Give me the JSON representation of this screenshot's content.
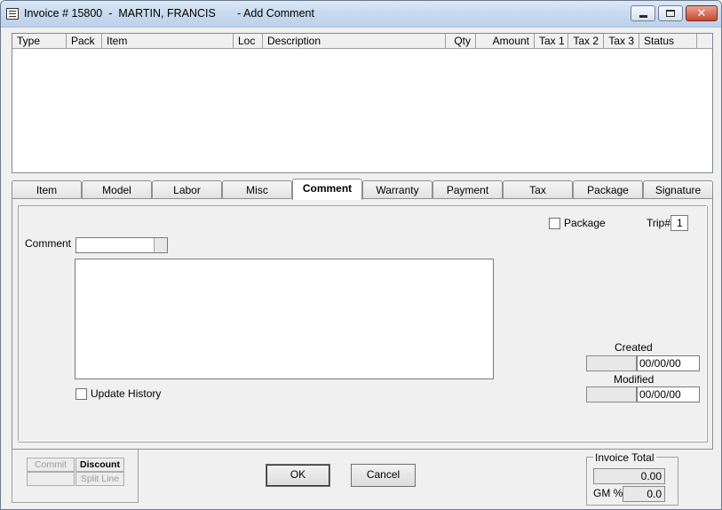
{
  "window": {
    "title": "Invoice # 15800  -  MARTIN, FRANCIS       - Add Comment"
  },
  "grid": {
    "columns": [
      "Type",
      "Pack",
      "Item",
      "Loc",
      "Description",
      "Qty",
      "Amount",
      "Tax 1",
      "Tax 2",
      "Tax 3",
      "Status"
    ]
  },
  "tabs": [
    {
      "label": "Item"
    },
    {
      "label": "Model"
    },
    {
      "label": "Labor"
    },
    {
      "label": "Misc"
    },
    {
      "label": "Comment"
    },
    {
      "label": "Warranty"
    },
    {
      "label": "Payment"
    },
    {
      "label": "Tax"
    },
    {
      "label": "Package"
    },
    {
      "label": "Signature"
    }
  ],
  "comment_tab": {
    "comment_label": "Comment",
    "package_label": "Package",
    "trip_label": "Trip#",
    "trip_value": "1",
    "update_history_label": "Update History",
    "created_label": "Created",
    "created_date": "00/00/00",
    "modified_label": "Modified",
    "modified_date": "00/00/00"
  },
  "bottom": {
    "commit_label": "Commit",
    "discount_label": "Discount",
    "split_line_label": "Split Line",
    "ok_label": "OK",
    "cancel_label": "Cancel",
    "invoice_total_label": "Invoice Total",
    "invoice_total_value": "0.00",
    "gm_label": "GM %",
    "gm_value": "0.0"
  }
}
